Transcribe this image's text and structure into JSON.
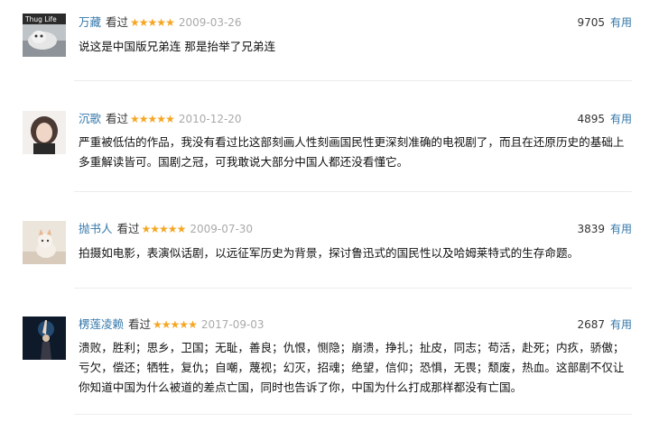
{
  "reviews": [
    {
      "user": "万藏",
      "status": "看过",
      "stars": "★★★★★",
      "date": "2009-03-26",
      "votes": "9705",
      "useful": "有用",
      "avatar_text": "Thug Life",
      "text": "说这是中国版兄弟连 那是抬举了兄弟连"
    },
    {
      "user": "沉歌",
      "status": "看过",
      "stars": "★★★★★",
      "date": "2010-12-20",
      "votes": "4895",
      "useful": "有用",
      "text": "严重被低估的作品，我没有看过比这部刻画人性刻画国民性更深刻准确的电视剧了，而且在还原历史的基础上多重解读皆可。国剧之冠，可我敢说大部分中国人都还没看懂它。"
    },
    {
      "user": "抛书人",
      "status": "看过",
      "stars": "★★★★★",
      "date": "2009-07-30",
      "votes": "3839",
      "useful": "有用",
      "text": "拍摄如电影，表演似话剧，以远征军历史为背景，探讨鲁迅式的国民性以及哈姆莱特式的生存命题。"
    },
    {
      "user": "楞莲凌赖",
      "status": "看过",
      "stars": "★★★★★",
      "date": "2017-09-03",
      "votes": "2687",
      "useful": "有用",
      "text": "溃败，胜利；思乡，卫国；无耻，善良；仇恨，恻隐；崩溃，挣扎；扯皮，同志；苟活，赴死；内疚，骄傲；亏欠，偿还；牺牲，复仇；自嘲，蔑视；幻灭，招魂；绝望，信仰；恐惧，无畏；颓废，热血。这部剧不仅让你知道中国为什么被道的差点亡国，同时也告诉了你，中国为什么打成那样都没有亡国。"
    }
  ],
  "colors": {
    "link": "#3377aa",
    "star": "#f5a623",
    "date": "#aaaaaa",
    "separator": "#ececec"
  }
}
